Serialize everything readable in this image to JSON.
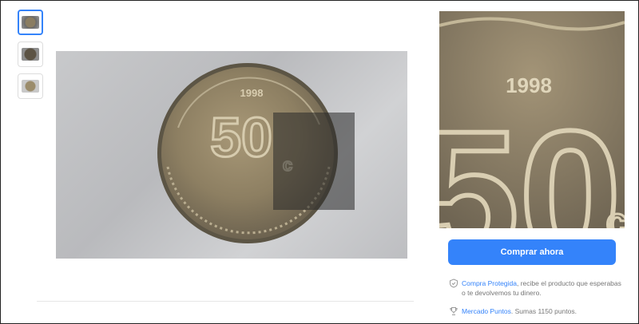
{
  "gallery": {
    "thumbnails": [
      {
        "name": "thumbnail-1",
        "active": true
      },
      {
        "name": "thumbnail-2",
        "active": false
      },
      {
        "name": "thumbnail-3",
        "active": false
      }
    ],
    "coin_year": "1998",
    "coin_denomination": "50",
    "coin_unit": "c"
  },
  "purchase": {
    "buy_label": "Comprar ahora",
    "accent_color": "#3483fa"
  },
  "benefits": [
    {
      "icon": "shield-icon",
      "link": "Compra Protegida",
      "text": ", recibe el producto que esperabas o te devolvemos tu dinero."
    },
    {
      "icon": "trophy-icon",
      "link": "Mercado Puntos",
      "text": ". Sumas 1150 puntos."
    }
  ]
}
